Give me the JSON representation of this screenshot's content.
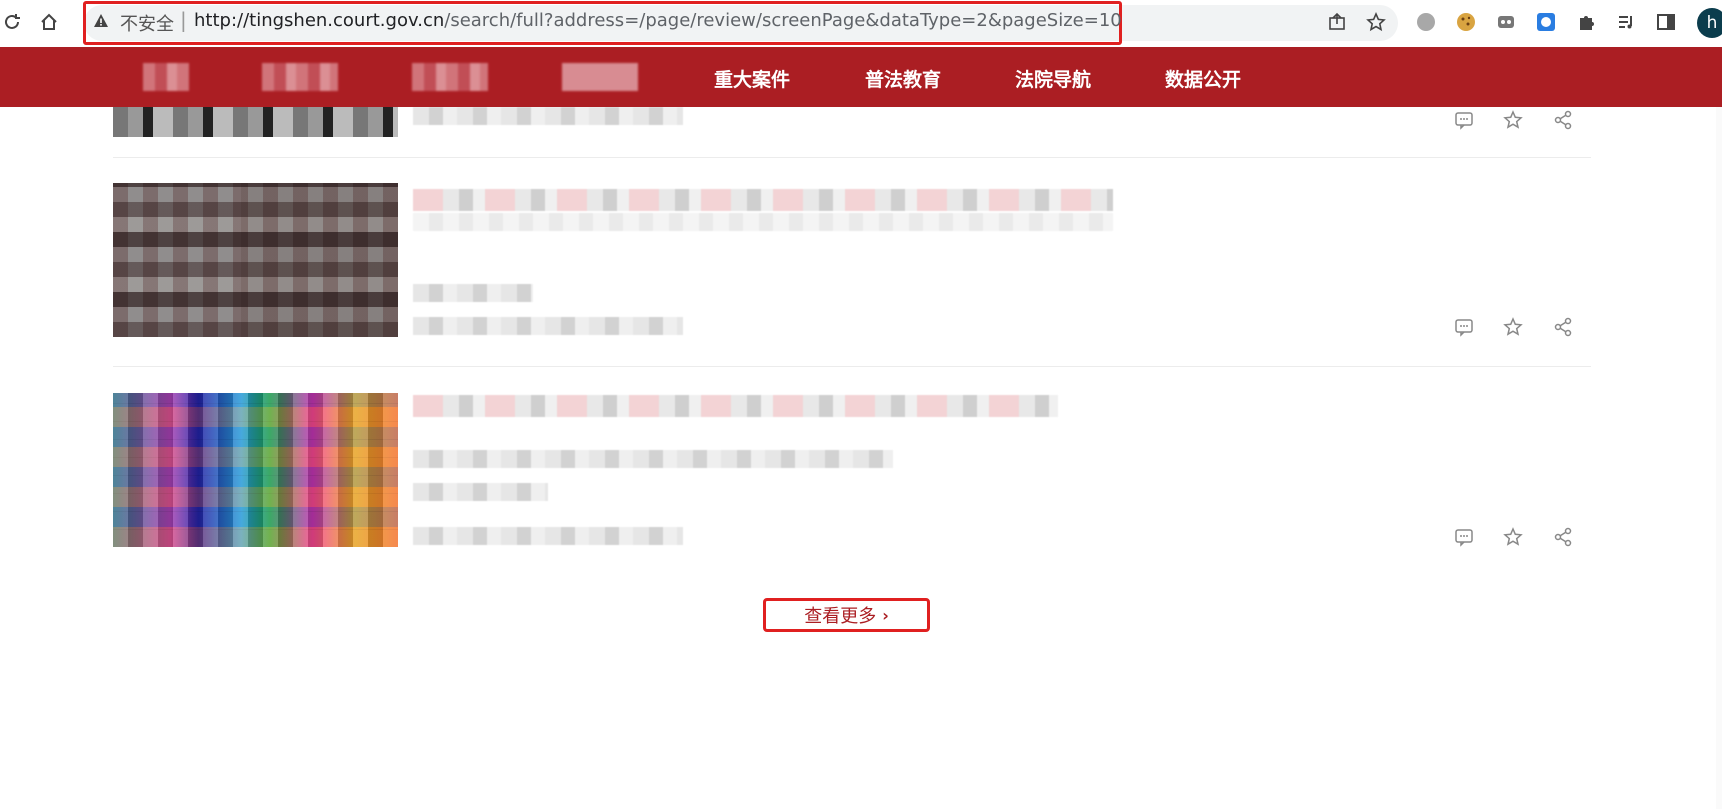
{
  "browser": {
    "security_label": "不安全",
    "separator": "|",
    "url_host": "http://tingshen.court.gov.cn",
    "url_path": "/search/full?address=/page/review/screenPage&dataType=2&pageSize=10",
    "profile_initial": "h",
    "toolbar_icons": [
      "reload-icon",
      "home-icon",
      "share-icon",
      "star-icon",
      "extension-circle-icon",
      "cookie-icon",
      "extension-mask-icon",
      "extension-bird-icon",
      "puzzle-icon",
      "media-control-icon",
      "side-panel-icon"
    ]
  },
  "nav": {
    "items": [
      {
        "label": "",
        "blurred": true
      },
      {
        "label": "",
        "blurred": true
      },
      {
        "label": "",
        "blurred": true
      },
      {
        "label": "",
        "blurred": true
      },
      {
        "label": "重大案件",
        "blurred": false
      },
      {
        "label": "普法教育",
        "blurred": false
      },
      {
        "label": "法院导航",
        "blurred": false
      },
      {
        "label": "数据公开",
        "blurred": false
      }
    ]
  },
  "results": {
    "action_icons": [
      "comment-icon",
      "star-icon",
      "share-icon"
    ]
  },
  "more_button": {
    "label": "查看更多",
    "chevron": "›"
  },
  "colors": {
    "brand_red": "#ab1e23",
    "highlight_red": "#e02020",
    "omnibox_bg": "#f1f3f4"
  }
}
